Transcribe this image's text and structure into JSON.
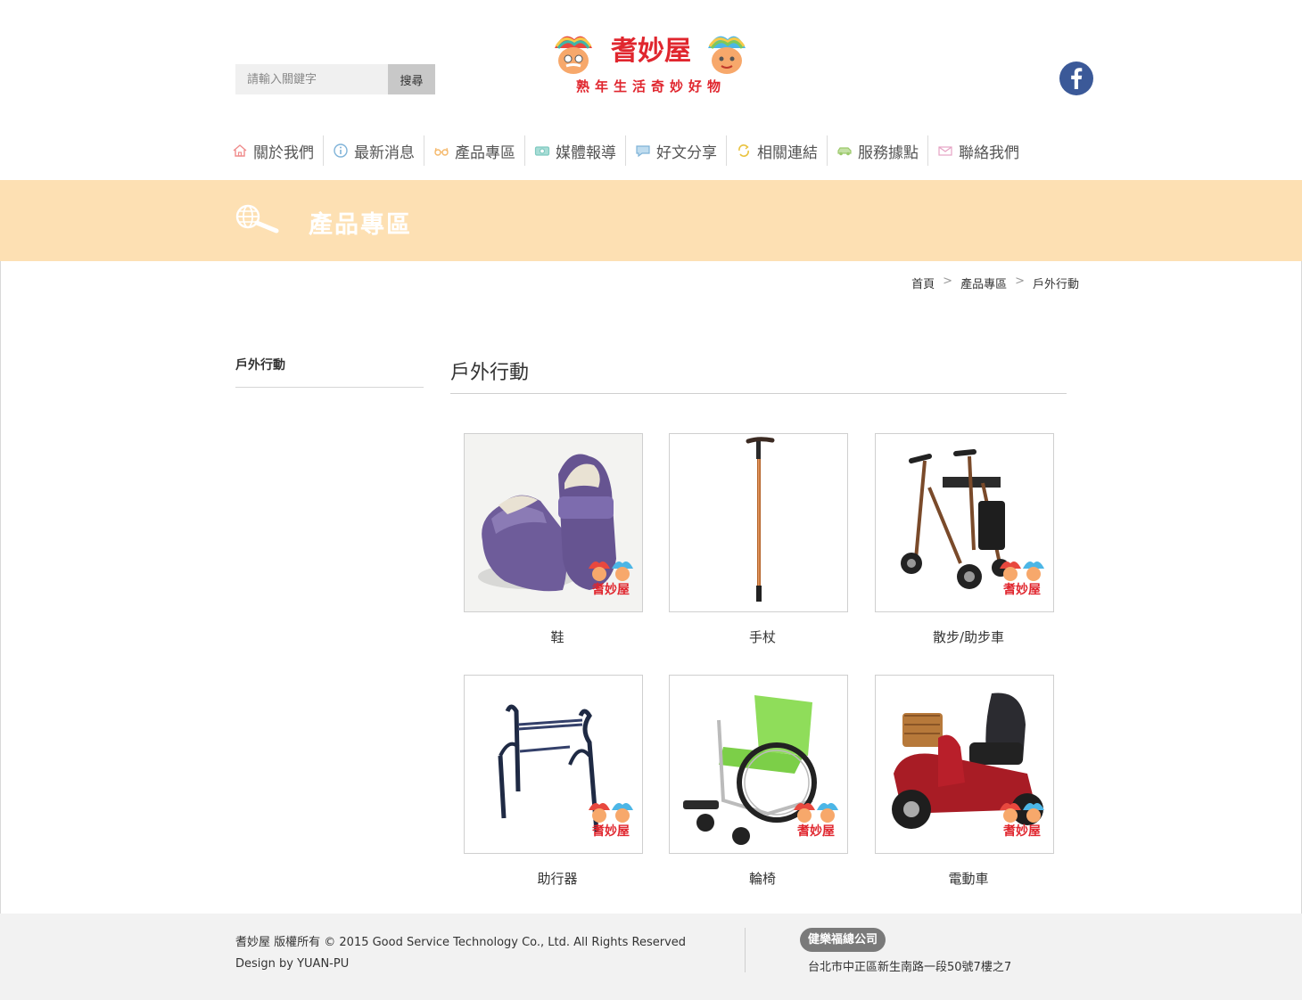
{
  "search": {
    "placeholder": "請輸入關鍵字",
    "button_label": "搜尋"
  },
  "logo": {
    "name": "耆妙屋",
    "tagline": "熟年生活奇妙好物"
  },
  "nav": [
    {
      "label": "關於我們",
      "icon": "home-icon",
      "color": "#f08c8c"
    },
    {
      "label": "最新消息",
      "icon": "info-icon",
      "color": "#7fb3d8"
    },
    {
      "label": "產品專區",
      "icon": "glasses-icon",
      "color": "#f5b86a"
    },
    {
      "label": "媒體報導",
      "icon": "camera-icon",
      "color": "#7ec9c0"
    },
    {
      "label": "好文分享",
      "icon": "chat-icon",
      "color": "#7fb3d8"
    },
    {
      "label": "相關連結",
      "icon": "link-icon",
      "color": "#e9c23d"
    },
    {
      "label": "服務據點",
      "icon": "car-icon",
      "color": "#9cc96b"
    },
    {
      "label": "聯絡我們",
      "icon": "mail-icon",
      "color": "#e6a3c4"
    }
  ],
  "banner": {
    "title": "產品專區",
    "color": "#fde0b3"
  },
  "breadcrumb": [
    "首頁",
    "產品專區",
    "戶外行動"
  ],
  "breadcrumb_separator": ">",
  "sidebar": {
    "items": [
      "戶外行動"
    ]
  },
  "main": {
    "title": "戶外行動",
    "products": [
      {
        "label": "鞋",
        "image": "shoes"
      },
      {
        "label": "手杖",
        "image": "cane"
      },
      {
        "label": "散步/助步車",
        "image": "rollator"
      },
      {
        "label": "助行器",
        "image": "walker"
      },
      {
        "label": "輪椅",
        "image": "wheelchair"
      },
      {
        "label": "電動車",
        "image": "scooter"
      }
    ]
  },
  "footer": {
    "copyright": "耆妙屋 版權所有 © 2015 Good Service Technology Co., Ltd. All Rights Reserved",
    "design_by": "Design by YUAN-PU",
    "company": "健樂福總公司",
    "address": "台北市中正區新生南路一段50號7樓之7"
  }
}
